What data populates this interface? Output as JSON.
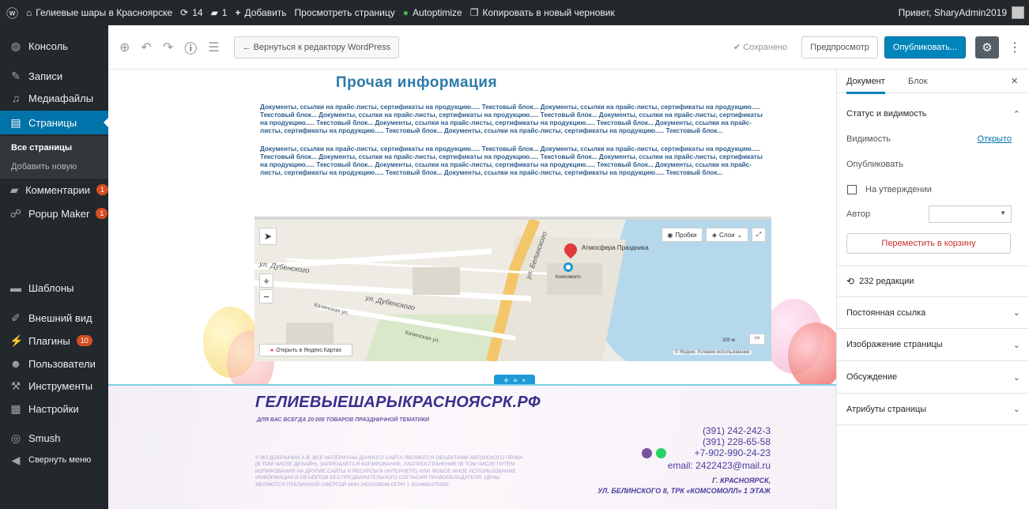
{
  "adminbar": {
    "site_name": "Гелиевые шары в Красноярске",
    "updates_count": "14",
    "comments_count": "1",
    "add_label": "Добавить",
    "view_page_label": "Просмотреть страницу",
    "autoptimize_label": "Autoptimize",
    "copy_draft_label": "Копировать в новый черновик",
    "greeting": "Привет, SharyAdmin2019"
  },
  "sidebar": {
    "items": [
      {
        "label": "Консоль",
        "icon": "dashboard-icon"
      },
      {
        "label": "Записи",
        "icon": "pin-icon"
      },
      {
        "label": "Медиафайлы",
        "icon": "media-icon"
      },
      {
        "label": "Страницы",
        "icon": "pages-icon"
      },
      {
        "label": "Комментарии",
        "icon": "comments-icon",
        "badge": "1"
      },
      {
        "label": "Popup Maker",
        "icon": "popup-icon",
        "badge": "1"
      },
      {
        "label": "Шаблоны",
        "icon": "folder-icon"
      },
      {
        "label": "Внешний вид",
        "icon": "brush-icon"
      },
      {
        "label": "Плагины",
        "icon": "plugin-icon",
        "badge": "10"
      },
      {
        "label": "Пользователи",
        "icon": "users-icon"
      },
      {
        "label": "Инструменты",
        "icon": "wrench-icon"
      },
      {
        "label": "Настройки",
        "icon": "settings-icon"
      },
      {
        "label": "Smush",
        "icon": "smush-icon"
      },
      {
        "label": "Свернуть меню",
        "icon": "collapse-icon"
      }
    ],
    "sub_items": [
      "Все страницы",
      "Добавить новую"
    ]
  },
  "toolbar": {
    "back_label": "← Вернуться к редактору WordPress",
    "saved_label": "✔ Сохранено",
    "preview_label": "Предпросмотр",
    "publish_label": "Опубликовать..."
  },
  "content": {
    "page_title": "Прочая информация",
    "paragraph1": "Документы, ссылки на прайс-листы, сертификаты на продукцию..... Текстовый блок... Документы, ссылки на прайс-листы, сертификаты на продукцию..... Текстовый блок... Документы, ссылки на прайс-листы, сертификаты на продукцию..... Текстовый блок... Документы, ссылки на прайс-листы, сертификаты на продукцию..... Текстовый блок... Документы, ссылки на прайс-листы, сертификаты на продукцию..... Текстовый блок... Документы, ссылки на прайс-листы, сертификаты на продукцию..... Текстовый блок... Документы, ссылки на прайс-листы, сертификаты на продукцию..... Текстовый блок...",
    "paragraph2": "Документы, ссылки на прайс-листы, сертификаты на продукцию..... Текстовый блок... Документы, ссылки на прайс-листы, сертификаты на продукцию..... Текстовый блок... Документы, ссылки на прайс-листы, сертификаты на продукцию..... Текстовый блок... Документы, ссылки на прайс-листы, сертификаты на продукцию..... Текстовый блок... Документы, ссылки на прайс-листы, сертификаты на продукцию..... Текстовый блок... Документы, ссылки на прайс-листы, сертификаты на продукцию..... Текстовый блок... Документы, ссылки на прайс-листы, сертификаты на продукцию..... Текстовый блок..."
  },
  "map": {
    "traffic_label": "Пробки",
    "layers_label": "Слои",
    "place_label": "Атмосфера Праздника",
    "mall_label": "Комсомолл",
    "street1": "ул. Дубенского",
    "street2": "ул. Дубенского",
    "street3": "ул. Белинского",
    "street4": "Качинская ул.",
    "street5": "Качинская ул.",
    "open_label": "Открыть в Яндекс.Картах",
    "scale_label": "200 м",
    "terms_label": "© Яндекс Условия использования"
  },
  "footer": {
    "site_title": "ГЕЛИЕВЫЕШАРЫКРАСНОЯСРК.РФ",
    "tagline": "ДЛЯ ВАС ВСЕГДА 20 000 ТОВАРОВ ПРАЗДНИЧНОЙ ТЕМАТИКИ",
    "phone1": "(391) 242-242-3",
    "phone2": "(391) 228-65-58",
    "phone3": "+7-902-990-24-23",
    "email": "email: 2422423@mail.ru",
    "city": "Г. КРАСНОЯРСК,",
    "address": "УЛ. БЕЛИНСКОГО 8, ТРК «КОМСОМОЛЛ» 1 ЭТАЖ",
    "legal": "© ИП ДОБРЫНИН А.В. ВСЕ МАТЕРИАЛЫ ДАННОГО САЙТА ЯВЛЯЮТСЯ ОБЪЕКТАМИ АВТОРСКОГО ПРАВА (В ТОМ ЧИСЛЕ ДИЗАЙН). ЗАПРЕЩАЕТСЯ КОПИРОВАНИЕ, РАСПРОСТРАНЕНИЕ (В ТОМ ЧИСЛЕ ПУТЕМ КОПИРОВАНИЯ НА ДРУГИЕ САЙТЫ И РЕСУРСЫ В ИНТЕРНЕТЕ) ИЛИ ЛЮБОЕ ИНОЕ ИСПОЛЬЗОВАНИЕ ИНФОРМАЦИИ И ОБЪЕКТОВ БЕЗ ПРЕДВАРИТЕЛЬНОГО СОГЛАСИЯ ПРАВООБЛАДАТЕЛЯ. ЦЕНЫ ЯВЛЯЮТСЯ ПУБЛИЧНОЙ ОФЕРТОЙ ИНН 2431028546 ОГРН 1 3024660270590"
  },
  "panel": {
    "tab_document": "Документ",
    "tab_block": "Блок",
    "status_title": "Статус и видимость",
    "visibility_label": "Видимость",
    "visibility_value": "Открыто",
    "publish_label": "Опубликовать",
    "pending_label": "На утверждении",
    "author_label": "Автор",
    "trash_label": "Переместить в корзину",
    "revisions_label": "232 редакции",
    "sections": [
      "Постоянная ссылка",
      "Изображение страницы",
      "Обсуждение",
      "Атрибуты страницы"
    ]
  },
  "colors": {
    "accent": "#0073aa",
    "primary_button": "#0085ba",
    "adminbar": "#23282d",
    "title": "#2c7aa9",
    "footer_text": "#4a3d9a"
  }
}
